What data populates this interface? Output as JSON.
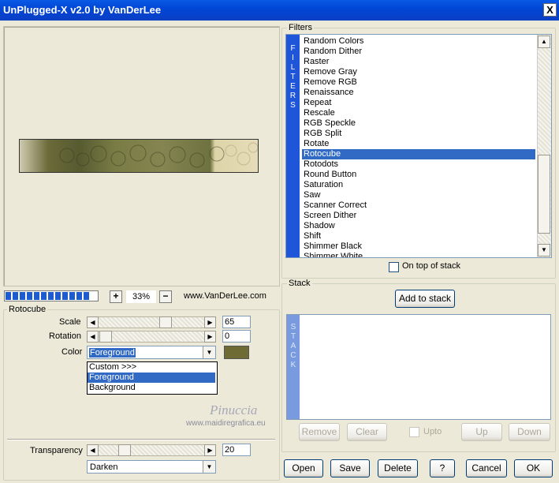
{
  "window": {
    "title": "UnPlugged-X v2.0 by VanDerLee",
    "close_label": "X"
  },
  "preview": {
    "zoom": "33%",
    "zoom_in": "+",
    "zoom_out": "−",
    "site": "www.VanDerLee.com",
    "progress_segments": 12
  },
  "params": {
    "group_title": "Rotocube",
    "scale": {
      "label": "Scale",
      "value": "65"
    },
    "rotation": {
      "label": "Rotation",
      "value": "0"
    },
    "color": {
      "label": "Color",
      "value": "Foreground",
      "swatch": "#6e6b34"
    },
    "color_options": [
      "Custom >>>",
      "Foreground",
      "Background"
    ],
    "transparency": {
      "label": "Transparency",
      "value": "20"
    },
    "blend_mode": "Darken"
  },
  "watermark": {
    "name": "Pinuccia",
    "url": "www.maidiregrafica.eu"
  },
  "filters": {
    "group_title": "Filters",
    "vertical_label": [
      "F",
      "I",
      "L",
      "T",
      "E",
      "R",
      "S"
    ],
    "items": [
      "Random Colors",
      "Random Dither",
      "Raster",
      "Remove Gray",
      "Remove RGB",
      "Renaissance",
      "Repeat",
      "Rescale",
      "RGB Speckle",
      "RGB Split",
      "Rotate",
      "Rotocube",
      "Rotodots",
      "Round Button",
      "Saturation",
      "Saw",
      "Scanner Correct",
      "Screen Dither",
      "Shadow",
      "Shift",
      "Shimmer Black",
      "Shimmer White"
    ],
    "selected": "Rotocube",
    "on_top_label": "On top of stack"
  },
  "stack": {
    "group_title": "Stack",
    "vertical_label": [
      "S",
      "T",
      "A",
      "C",
      "K"
    ],
    "add_label": "Add to stack",
    "remove_label": "Remove",
    "clear_label": "Clear",
    "upto_label": "Upto",
    "up_label": "Up",
    "down_label": "Down"
  },
  "footer": {
    "open": "Open",
    "save": "Save",
    "delete": "Delete",
    "help": "?",
    "cancel": "Cancel",
    "ok": "OK"
  },
  "colors": {
    "title_bar": "#0046d6",
    "selection": "#316ac5",
    "filters_bar": "#1f55d8",
    "stack_bar": "#7a9ae0"
  }
}
